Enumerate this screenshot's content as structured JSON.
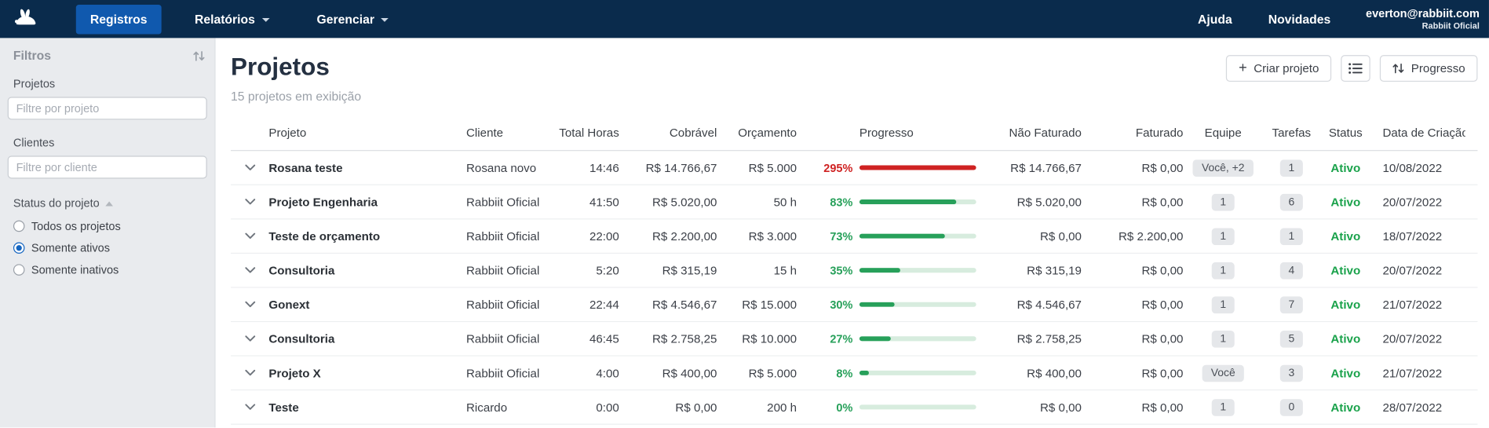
{
  "colors": {
    "navbar_bg": "#0a2b4c",
    "nav_active_bg": "#1059ae",
    "progress_ok": "#27a05a",
    "progress_over": "#cf2222",
    "progress_track": "#d7ecde",
    "status_active": "#1aa24b",
    "radio_selected": "#1565c0"
  },
  "navbar": {
    "items": [
      {
        "label": "Registros",
        "active": true
      },
      {
        "label": "Relatórios",
        "dropdown": true
      },
      {
        "label": "Gerenciar",
        "dropdown": true
      }
    ],
    "help": "Ajuda",
    "news": "Novidades",
    "user": {
      "email": "everton@rabbiit.com",
      "org": "Rabbiit Oficial"
    }
  },
  "sidebar": {
    "title": "Filtros",
    "project_filter": {
      "label": "Projetos",
      "placeholder": "Filtre por projeto"
    },
    "client_filter": {
      "label": "Clientes",
      "placeholder": "Filtre por cliente"
    },
    "status_group": {
      "label": "Status do projeto",
      "options": [
        {
          "label": "Todos os projetos",
          "selected": false
        },
        {
          "label": "Somente ativos",
          "selected": true
        },
        {
          "label": "Somente inativos",
          "selected": false
        }
      ]
    }
  },
  "main": {
    "title": "Projetos",
    "subtitle": "15 projetos em exibição",
    "actions": {
      "create_label": "Criar projeto",
      "view_icon": "list-view-icon",
      "sort_label": "Progresso"
    },
    "table": {
      "columns": [
        "Projeto",
        "Cliente",
        "Total Horas",
        "Cobrável",
        "Orçamento",
        "Progresso",
        "Não Faturado",
        "Faturado",
        "Equipe",
        "Tarefas",
        "Status",
        "Data de Criação"
      ],
      "rows": [
        {
          "projeto": "Rosana teste",
          "cliente": "Rosana novo",
          "total_horas": "14:46",
          "cobravel": "R$ 14.766,67",
          "orcamento": "R$ 5.000",
          "progresso": "295%",
          "progress_value": 295,
          "over_budget": true,
          "nao_faturado": "R$ 14.766,67",
          "faturado": "R$ 0,00",
          "equipe": "Você, +2",
          "tarefas": "1",
          "status": "Ativo",
          "data": "10/08/2022"
        },
        {
          "projeto": "Projeto Engenharia",
          "cliente": "Rabbiit Oficial",
          "total_horas": "41:50",
          "cobravel": "R$ 5.020,00",
          "orcamento": "50 h",
          "progresso": "83%",
          "progress_value": 83,
          "over_budget": false,
          "nao_faturado": "R$ 5.020,00",
          "faturado": "R$ 0,00",
          "equipe": "1",
          "tarefas": "6",
          "status": "Ativo",
          "data": "20/07/2022"
        },
        {
          "projeto": "Teste de orçamento",
          "cliente": "Rabbiit Oficial",
          "total_horas": "22:00",
          "cobravel": "R$ 2.200,00",
          "orcamento": "R$ 3.000",
          "progresso": "73%",
          "progress_value": 73,
          "over_budget": false,
          "nao_faturado": "R$ 0,00",
          "faturado": "R$ 2.200,00",
          "equipe": "1",
          "tarefas": "1",
          "status": "Ativo",
          "data": "18/07/2022"
        },
        {
          "projeto": "Consultoria",
          "cliente": "Rabbiit Oficial",
          "total_horas": "5:20",
          "cobravel": "R$ 315,19",
          "orcamento": "15 h",
          "progresso": "35%",
          "progress_value": 35,
          "over_budget": false,
          "nao_faturado": "R$ 315,19",
          "faturado": "R$ 0,00",
          "equipe": "1",
          "tarefas": "4",
          "status": "Ativo",
          "data": "20/07/2022"
        },
        {
          "projeto": "Gonext",
          "cliente": "Rabbiit Oficial",
          "total_horas": "22:44",
          "cobravel": "R$ 4.546,67",
          "orcamento": "R$ 15.000",
          "progresso": "30%",
          "progress_value": 30,
          "over_budget": false,
          "nao_faturado": "R$ 4.546,67",
          "faturado": "R$ 0,00",
          "equipe": "1",
          "tarefas": "7",
          "status": "Ativo",
          "data": "21/07/2022"
        },
        {
          "projeto": "Consultoria",
          "cliente": "Rabbiit Oficial",
          "total_horas": "46:45",
          "cobravel": "R$ 2.758,25",
          "orcamento": "R$ 10.000",
          "progresso": "27%",
          "progress_value": 27,
          "over_budget": false,
          "nao_faturado": "R$ 2.758,25",
          "faturado": "R$ 0,00",
          "equipe": "1",
          "tarefas": "5",
          "status": "Ativo",
          "data": "20/07/2022"
        },
        {
          "projeto": "Projeto X",
          "cliente": "Rabbiit Oficial",
          "total_horas": "4:00",
          "cobravel": "R$ 400,00",
          "orcamento": "R$ 5.000",
          "progresso": "8%",
          "progress_value": 8,
          "over_budget": false,
          "nao_faturado": "R$ 400,00",
          "faturado": "R$ 0,00",
          "equipe": "Você",
          "tarefas": "3",
          "status": "Ativo",
          "data": "21/07/2022"
        },
        {
          "projeto": "Teste",
          "cliente": "Ricardo",
          "total_horas": "0:00",
          "cobravel": "R$ 0,00",
          "orcamento": "200 h",
          "progresso": "0%",
          "progress_value": 0,
          "over_budget": false,
          "nao_faturado": "R$ 0,00",
          "faturado": "R$ 0,00",
          "equipe": "1",
          "tarefas": "0",
          "status": "Ativo",
          "data": "28/07/2022"
        }
      ]
    }
  }
}
